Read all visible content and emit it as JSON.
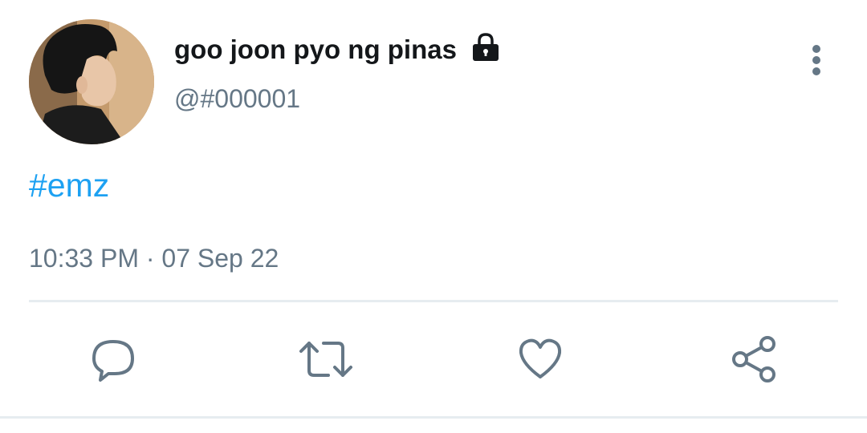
{
  "tweet": {
    "display_name": "goo joon pyo ng pinas",
    "handle": "@#000001",
    "protected_icon": "lock-icon",
    "more_icon": "more-vertical-icon",
    "body_hashtag": "#emz",
    "timestamp": "10:33 PM · 07 Sep 22"
  },
  "actions": [
    {
      "name": "reply",
      "icon": "reply-icon"
    },
    {
      "name": "retweet",
      "icon": "retweet-icon"
    },
    {
      "name": "like",
      "icon": "heart-icon"
    },
    {
      "name": "share",
      "icon": "share-icon"
    }
  ],
  "colors": {
    "text_primary": "#14171a",
    "text_secondary": "#657786",
    "link": "#1da1f2",
    "icon": "#657786",
    "divider": "#e6ecf0"
  }
}
